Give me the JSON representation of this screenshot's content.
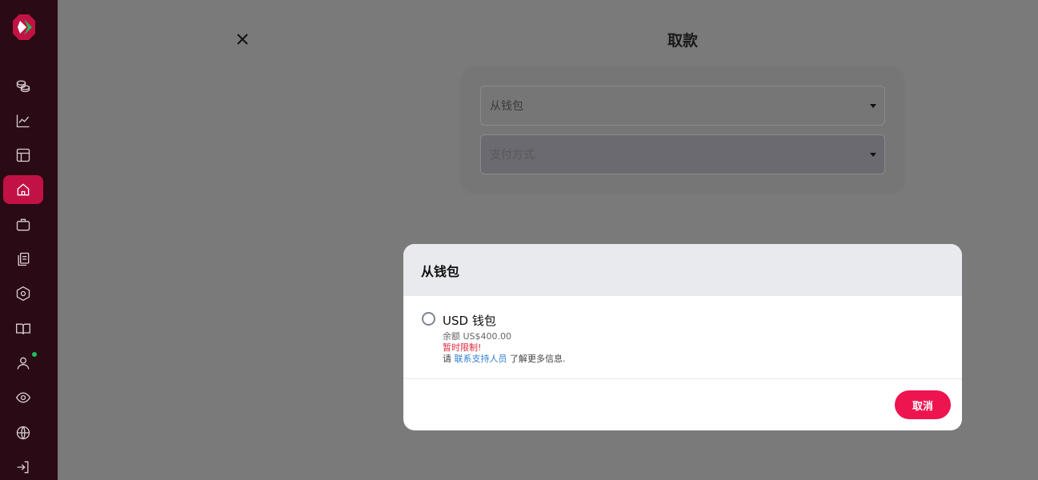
{
  "page": {
    "title": "取款"
  },
  "form": {
    "wallet_select": "从钱包",
    "payment_select": "支付方式"
  },
  "modal": {
    "title": "从钱包",
    "option": {
      "name": "USD 钱包",
      "balance": "余额 US$400.00",
      "restricted": "暂时限制!",
      "info_prefix": "请",
      "info_link": "联系支持人员",
      "info_suffix": "了解更多信息."
    },
    "cancel_label": "取消"
  },
  "colors": {
    "sidebar": "#2a0a14",
    "accent": "#ee1450",
    "active_nav": "#c21245",
    "link": "#2f7fd1",
    "warning": "#e0283c",
    "online_dot": "#1fbf5b"
  },
  "sidebar": {
    "items": [
      {
        "icon": "coins-icon"
      },
      {
        "icon": "chart-line-icon"
      },
      {
        "icon": "layout-icon"
      },
      {
        "icon": "home-icon",
        "active": true
      },
      {
        "icon": "briefcase-icon"
      },
      {
        "icon": "copy-docs-icon"
      },
      {
        "icon": "hexagon-settings-icon"
      },
      {
        "icon": "book-open-icon"
      },
      {
        "icon": "user-icon",
        "status_dot": true
      },
      {
        "icon": "eye-icon"
      },
      {
        "icon": "globe-icon"
      },
      {
        "icon": "logout-icon"
      }
    ]
  }
}
